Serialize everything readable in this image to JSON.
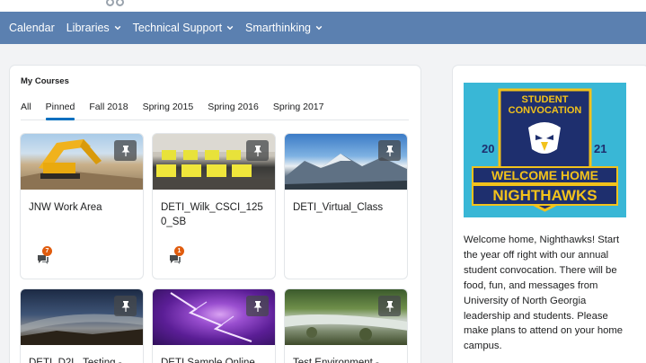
{
  "nav": {
    "items": [
      {
        "label": "Calendar",
        "has_menu": false
      },
      {
        "label": "Libraries",
        "has_menu": true
      },
      {
        "label": "Technical Support",
        "has_menu": true
      },
      {
        "label": "Smarthinking",
        "has_menu": true
      }
    ]
  },
  "courses": {
    "title": "My Courses",
    "tabs": [
      {
        "label": "All",
        "active": false
      },
      {
        "label": "Pinned",
        "active": true
      },
      {
        "label": "Fall 2018",
        "active": false
      },
      {
        "label": "Spring 2015",
        "active": false
      },
      {
        "label": "Spring 2016",
        "active": false
      },
      {
        "label": "Spring 2017",
        "active": false
      }
    ],
    "cards": [
      {
        "title": "JNW Work Area",
        "notifications": "7",
        "image": "construction-site"
      },
      {
        "title": "DETI_Wilk_CSCI_1250_SB",
        "notifications": "1",
        "image": "computer-lab"
      },
      {
        "title": "DETI_Virtual_Class",
        "notifications": "",
        "image": "mountains"
      },
      {
        "title": "DETI_D2L_Testing -",
        "notifications": "",
        "image": "night-sky"
      },
      {
        "title": "DETI Sample Online",
        "notifications": "",
        "image": "lightning"
      },
      {
        "title": "Test Environment -",
        "notifications": "",
        "image": "river"
      }
    ]
  },
  "announcement": {
    "banner": {
      "line1": "STUDENT",
      "line2": "CONVOCATION",
      "year_left": "20",
      "year_right": "21",
      "headline1": "WELCOME HOME",
      "headline2": "NIGHTHAWKS"
    },
    "text": "Welcome home, Nighthawks! Start the year off right with our annual student convocation. There will be food, fun, and messages from University of North Georgia leadership and students. Please make plans to attend on your home campus.",
    "colors": {
      "banner_bg": "#39b7d6",
      "shield": "#1e2f6e",
      "accent": "#f2c21b"
    }
  },
  "colors": {
    "navbar": "#5b80b0",
    "tab_active": "#006fbf",
    "badge": "#e05c0e"
  }
}
